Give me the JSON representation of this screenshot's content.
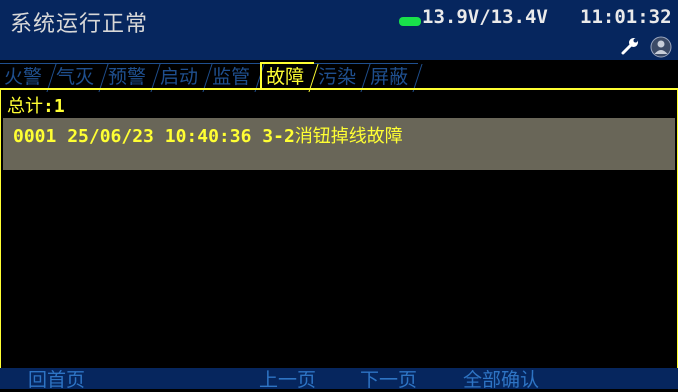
{
  "header": {
    "status": "系统运行正常",
    "voltage": "13.9V/13.4V",
    "time": "11:01:32",
    "battery_color": "#19e04a",
    "icons": [
      "wrench-icon",
      "user-icon"
    ]
  },
  "tabs": [
    {
      "label": "火警",
      "active": false
    },
    {
      "label": "气灭",
      "active": false
    },
    {
      "label": "预警",
      "active": false
    },
    {
      "label": "启动",
      "active": false
    },
    {
      "label": "监管",
      "active": false
    },
    {
      "label": "故障",
      "active": true
    },
    {
      "label": "污染",
      "active": false
    },
    {
      "label": "屏蔽",
      "active": false
    }
  ],
  "list": {
    "total_label": "总计",
    "total_sep": ":",
    "total_value": "1",
    "rows": [
      {
        "index": "0001",
        "date": "25/06/23",
        "time": "10:40:36",
        "code": "3-2",
        "desc": "消钮掉线故障"
      }
    ]
  },
  "footer": {
    "home": "回首页",
    "prev": "上一页",
    "next": "下一页",
    "confirm_all": "全部确认"
  },
  "colors": {
    "header_bg": "#06265e",
    "active_tab": "#ffff33",
    "inactive_tab": "#1f4f8e",
    "row_bg": "#696658",
    "footer_text": "#2e74c4"
  }
}
